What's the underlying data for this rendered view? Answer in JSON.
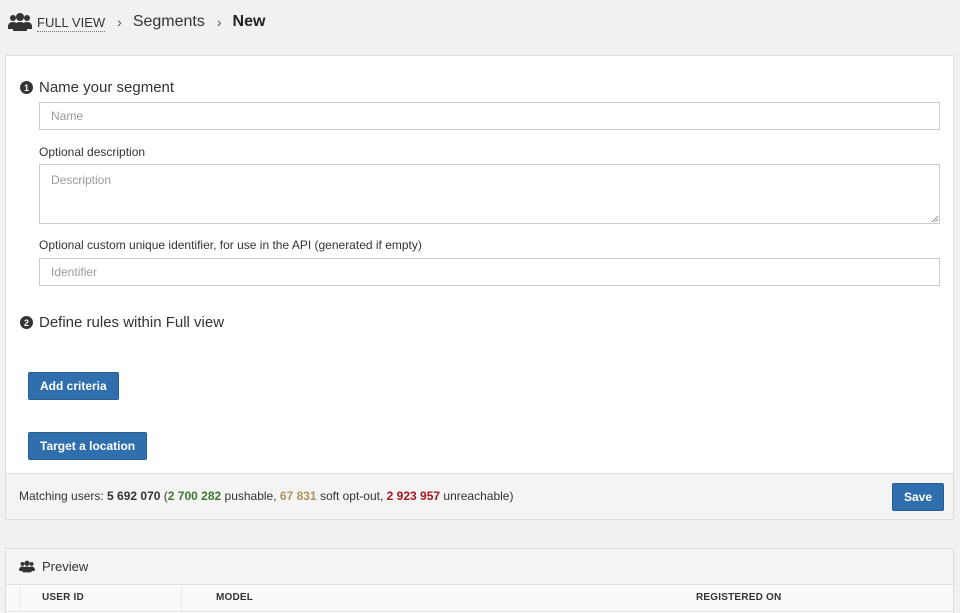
{
  "breadcrumb": {
    "root": "FULL VIEW",
    "middle": "Segments",
    "current": "New",
    "separator": "›",
    "icon": "users-icon"
  },
  "form": {
    "step1": {
      "number": "1",
      "title": "Name your segment"
    },
    "name": {
      "placeholder": "Name",
      "value": ""
    },
    "description": {
      "label": "Optional description",
      "placeholder": "Description",
      "value": ""
    },
    "identifier": {
      "label": "Optional custom unique identifier, for use in the API (generated if empty)",
      "placeholder": "Identifier",
      "value": ""
    },
    "step2": {
      "number": "2",
      "title": "Define rules within Full view"
    },
    "add_criteria_label": "Add criteria",
    "target_location_label": "Target a location"
  },
  "matching": {
    "prefix": "Matching users:",
    "total": "5 692 070",
    "pushable_count": "2 700 282",
    "pushable_text": "pushable",
    "softout_count": "67 831",
    "softout_text": "soft opt-out",
    "unreachable_count": "2 923 957",
    "unreachable_text": "unreachable",
    "colors": {
      "pushable": "#3d7a2f",
      "softout": "#b0935a",
      "unreachable": "#a3171e"
    }
  },
  "save_label": "Save",
  "preview": {
    "title": "Preview",
    "icon": "users-icon",
    "columns": [
      "USER ID",
      "MODEL",
      "REGISTERED ON"
    ]
  },
  "colors": {
    "accent": "#2f6fae"
  }
}
